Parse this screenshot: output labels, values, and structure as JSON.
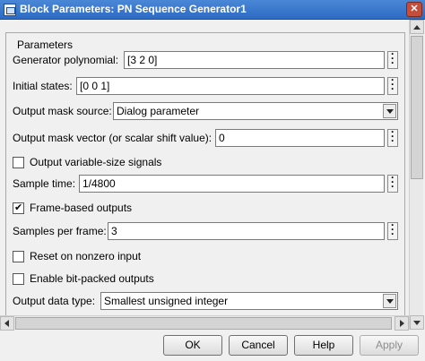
{
  "window": {
    "title": "Block Parameters: PN Sequence Generator1",
    "close_glyph": "✕"
  },
  "panel": {
    "legend": "Parameters"
  },
  "fields": {
    "generator_polynomial": {
      "label": "Generator polynomial:",
      "value": "[3 2 0]"
    },
    "initial_states": {
      "label": "Initial states:",
      "value": "[0 0 1]"
    },
    "output_mask_source": {
      "label": "Output mask source:",
      "value": "Dialog parameter"
    },
    "output_mask_vector": {
      "label": "Output mask vector (or scalar shift value):",
      "value": "0"
    },
    "output_variable_size": {
      "label": "Output variable-size signals",
      "checked": false
    },
    "sample_time": {
      "label": "Sample time:",
      "value": "1/4800"
    },
    "frame_based_outputs": {
      "label": "Frame-based outputs",
      "checked": true
    },
    "samples_per_frame": {
      "label": "Samples per frame:",
      "value": "3"
    },
    "reset_on_nonzero": {
      "label": "Reset on nonzero input",
      "checked": false
    },
    "enable_bit_packed": {
      "label": "Enable bit-packed outputs",
      "checked": false
    },
    "output_data_type": {
      "label": "Output data type:",
      "value": "Smallest unsigned integer"
    }
  },
  "buttons": {
    "ok": "OK",
    "cancel": "Cancel",
    "help": "Help",
    "apply": "Apply"
  },
  "colors": {
    "titlebar": "#2d6bc4",
    "dialog_bg": "#f0f0f0",
    "disabled_text": "#8d8d8d"
  },
  "icons": {
    "window": "block-parameters-icon",
    "field_menu": "vertical-ellipsis-icon",
    "dropdown": "chevron-down-icon"
  }
}
